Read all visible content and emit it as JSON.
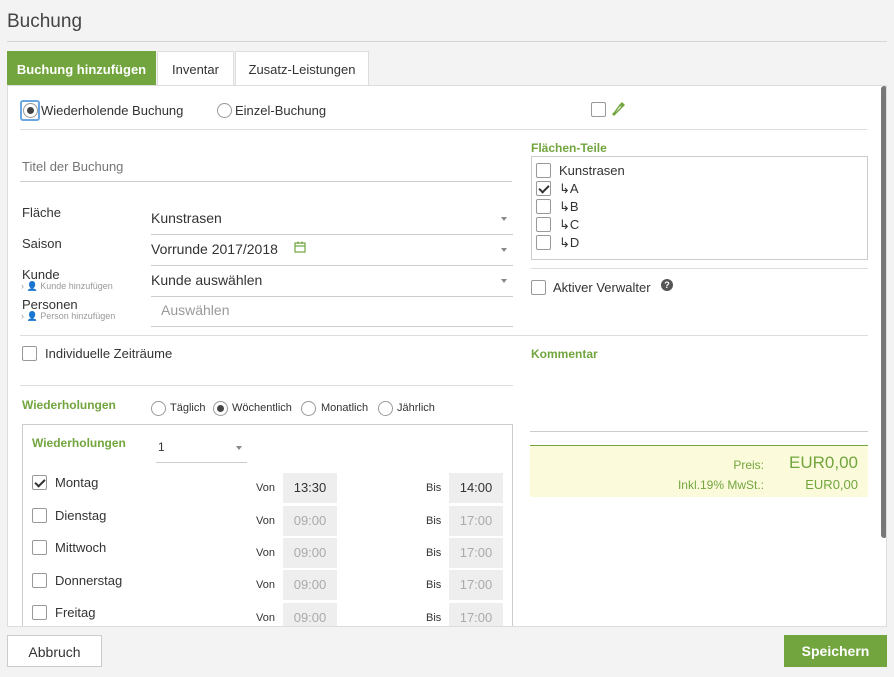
{
  "page": {
    "title": "Buchung"
  },
  "tabs": [
    {
      "label": "Buchung hinzufügen",
      "active": true
    },
    {
      "label": "Inventar",
      "active": false
    },
    {
      "label": "Zusatz-Leistungen",
      "active": false
    }
  ],
  "booking_type": {
    "recurring": "Wiederholende Buchung",
    "single": "Einzel-Buchung",
    "selected": "recurring"
  },
  "title_field": {
    "placeholder": "Titel der Buchung"
  },
  "form": {
    "flaeche": {
      "label": "Fläche",
      "value": "Kunstrasen"
    },
    "saison": {
      "label": "Saison",
      "value": "Vorrunde 2017/2018"
    },
    "kunde": {
      "label": "Kunde",
      "sub": "Kunde hinzufügen",
      "value": "Kunde auswählen"
    },
    "personen": {
      "label": "Personen",
      "sub": "Person hinzufügen",
      "placeholder": "Auswählen"
    }
  },
  "individual_periods": {
    "label": "Individuelle Zeiträume",
    "checked": false
  },
  "wiederholungen": {
    "label": "Wiederholungen",
    "options": [
      "Täglich",
      "Wöchentlich",
      "Monatlich",
      "Jährlich"
    ],
    "selected": "Wöchentlich",
    "inner_label": "Wiederholungen",
    "count": "1",
    "von_label": "Von",
    "bis_label": "Bis",
    "days": [
      {
        "name": "Montag",
        "checked": true,
        "von": "13:30",
        "bis": "14:00"
      },
      {
        "name": "Dienstag",
        "checked": false,
        "von": "09:00",
        "bis": "17:00"
      },
      {
        "name": "Mittwoch",
        "checked": false,
        "von": "09:00",
        "bis": "17:00"
      },
      {
        "name": "Donnerstag",
        "checked": false,
        "von": "09:00",
        "bis": "17:00"
      },
      {
        "name": "Freitag",
        "checked": false,
        "von": "09:00",
        "bis": "17:00"
      }
    ]
  },
  "flaechen_teile": {
    "label": "Flächen-Teile",
    "items": [
      {
        "label": "Kunstrasen",
        "checked": false
      },
      {
        "label": "↳A",
        "checked": true
      },
      {
        "label": "↳B",
        "checked": false
      },
      {
        "label": "↳C",
        "checked": false
      },
      {
        "label": "↳D",
        "checked": false
      }
    ]
  },
  "aktiver_verwalter": {
    "label": "Aktiver Verwalter",
    "checked": false
  },
  "kommentar": {
    "label": "Kommentar"
  },
  "price": {
    "preis_label": "Preis:",
    "preis_value": "EUR0,00",
    "mwst_label": "Inkl.19% MwSt.:",
    "mwst_value": "EUR0,00"
  },
  "buttons": {
    "cancel": "Abbruch",
    "save": "Speichern"
  },
  "colors": {
    "accent": "#72a53e",
    "price_bg": "#fbfbdc"
  }
}
